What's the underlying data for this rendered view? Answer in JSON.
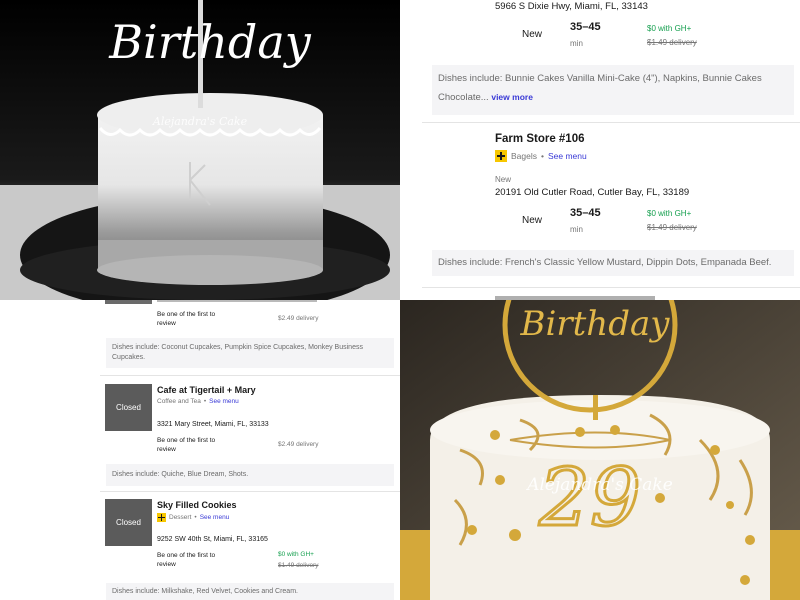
{
  "top_left_photo": {
    "topper_text": "Birthday",
    "watermark": "Alejandra's Cake"
  },
  "listing_top": {
    "partial_address": "5966 S Dixie Hwy, Miami, FL, 33143",
    "new_label": "New",
    "eta": "35–45",
    "eta_unit": "min",
    "gh_offer": "$0 with GH+",
    "fee": "$1.49 delivery",
    "dishes": "Dishes include: Bunnie Cakes Vanilla Mini-Cake (4\"), Napkins, Bunnie Cakes Chocolate...",
    "view_more": "view more"
  },
  "listing_farm": {
    "name": "Farm Store #106",
    "category": "Bagels",
    "see_menu": "See menu",
    "new_tag": "New",
    "address": "20191 Old Cutler Road, Cutler Bay, FL, 33189",
    "new_label": "New",
    "eta": "35–45",
    "eta_unit": "min",
    "gh_offer": "$0 with GH+",
    "fee": "$1.49 delivery",
    "dishes": "Dishes include: French's Classic Yellow Mustard, Dippin Dots, Empanada Beef."
  },
  "listing_partial_bl": {
    "review": "Be one of the first to review",
    "fee": "$2.49 delivery",
    "dishes": "Dishes include: Coconut Cupcakes, Pumpkin Spice Cupcakes, Monkey Business Cupcakes."
  },
  "listing_cafe": {
    "status": "Closed",
    "name": "Cafe at Tigertail + Mary",
    "category": "Coffee and Tea",
    "see_menu": "See menu",
    "address": "3321 Mary Street, Miami, FL, 33133",
    "review": "Be one of the first to review",
    "fee": "$2.49 delivery",
    "dishes": "Dishes include: Quiche, Blue Dream, Shots."
  },
  "listing_sky": {
    "status": "Closed",
    "name": "Sky Filled Cookies",
    "category": "Dessert",
    "see_menu": "See menu",
    "address": "9252 SW 40th St, Miami, FL, 33165",
    "review": "Be one of the first to review",
    "gh_offer": "$0 with GH+",
    "fee": "$1.49 delivery",
    "dishes": "Dishes include: Milkshake, Red Velvet, Cookies and Cream."
  },
  "bottom_right_photo": {
    "topper_text": "Birthday",
    "watermark": "Alejandra's Cake",
    "number": "29"
  },
  "colors": {
    "grubhub_plus_yellow": "#f7c700",
    "link_blue": "#3a3ad6",
    "offer_green": "#17a050",
    "gold": "#d4a83a"
  }
}
